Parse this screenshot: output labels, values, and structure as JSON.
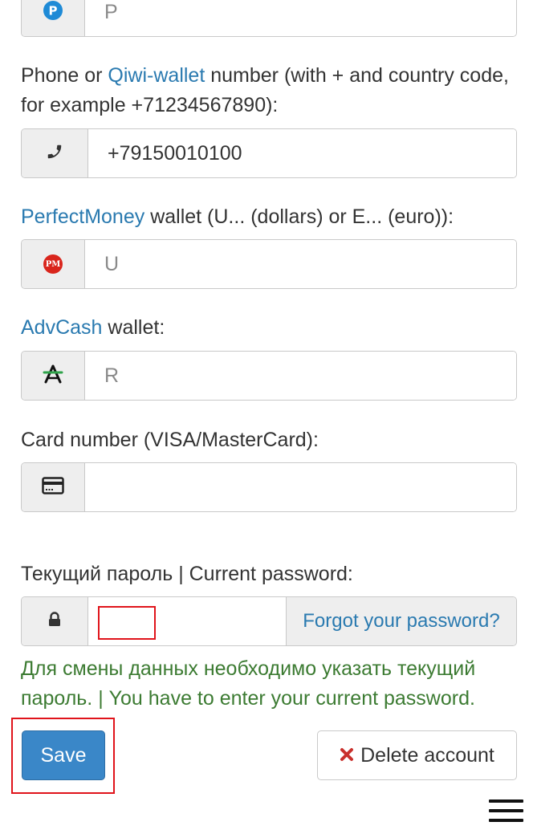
{
  "payeer": {
    "value": "P",
    "icon": "payeer-icon"
  },
  "phone": {
    "label_before": "Phone or ",
    "label_link": "Qiwi-wallet",
    "label_after": " number (with + and country code, for example +71234567890):",
    "value": "+79150010100",
    "icon": "phone-icon"
  },
  "perfectmoney": {
    "label_link": "PerfectMoney",
    "label_after": " wallet (U... (dollars) or E... (euro)):",
    "value": "U",
    "icon_text": "PM",
    "icon": "perfectmoney-icon"
  },
  "advcash": {
    "label_link": "AdvCash",
    "label_after": " wallet:",
    "value": "R",
    "icon": "advcash-icon"
  },
  "card": {
    "label": "Card number (VISA/MasterCard):",
    "value": "",
    "icon": "credit-card-icon"
  },
  "password": {
    "label": "Текущий пароль | Current password:",
    "value": "",
    "forgot_label": "Forgot your password?",
    "icon": "lock-icon"
  },
  "notice": "Для смены данных необходимо указать текущий пароль. | You have to enter your current password.",
  "actions": {
    "save_label": "Save",
    "delete_label": "Delete account",
    "delete_icon": "x-icon"
  },
  "menu": {
    "icon": "hamburger-menu-icon"
  },
  "colors": {
    "link": "#2a7ab0",
    "primary_button": "#3a87c8",
    "notice_text": "#3c7b32",
    "highlight_box": "#e0141b",
    "delete_icon": "#c9302c"
  }
}
